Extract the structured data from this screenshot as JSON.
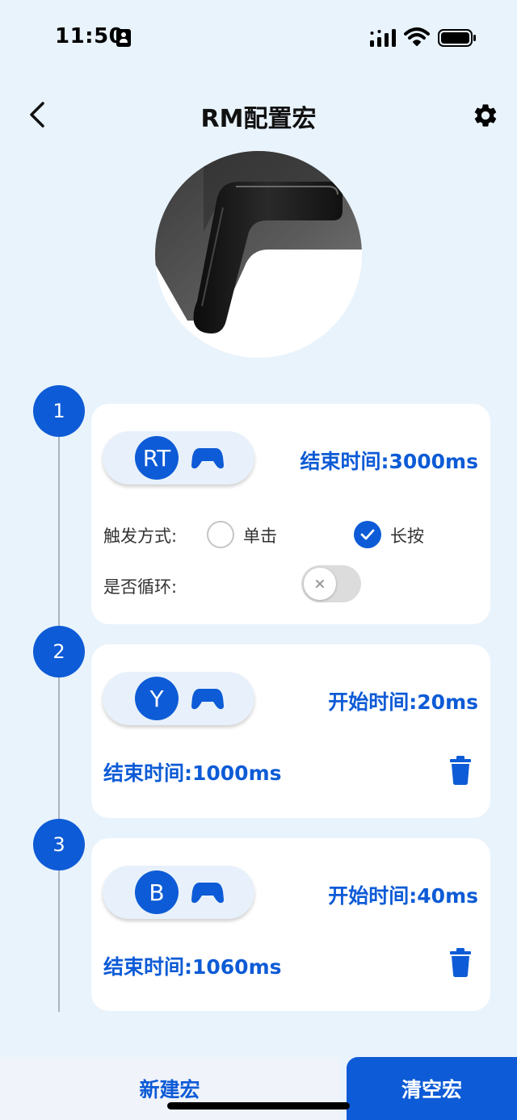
{
  "status": {
    "time": "11:50"
  },
  "header": {
    "title": "RM配置宏"
  },
  "steps": [
    {
      "number": "1",
      "key": "RT",
      "end_time": "结束时间:3000ms",
      "trigger_label": "触发方式:",
      "trigger_options": [
        "单击",
        "长按"
      ],
      "selected_trigger": "长按",
      "loop_label": "是否循环:",
      "loop_enabled": false
    },
    {
      "number": "2",
      "key": "Y",
      "start_time": "开始时间:20ms",
      "end_time": "结束时间:1000ms"
    },
    {
      "number": "3",
      "key": "B",
      "start_time": "开始时间:40ms",
      "end_time": "结束时间:1060ms"
    }
  ],
  "footer": {
    "new_label": "新建宏",
    "clear_label": "清空宏"
  },
  "colors": {
    "accent": "#0d5bd6",
    "background": "#e9f3fc",
    "card": "#ffffff"
  },
  "icons": [
    "back-arrow-icon",
    "gear-icon",
    "gamepad-icon",
    "check-icon",
    "close-icon",
    "trash-icon",
    "signal-icon",
    "wifi-icon",
    "battery-icon",
    "id-card-icon"
  ]
}
